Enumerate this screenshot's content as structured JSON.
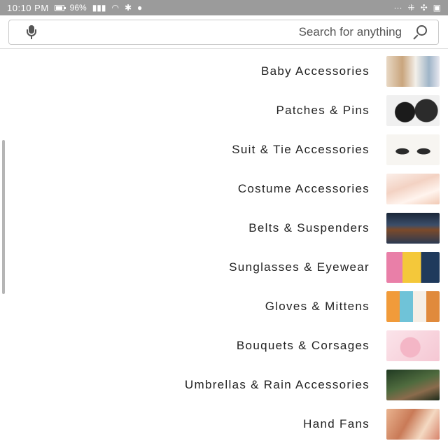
{
  "status_bar": {
    "time": "10:10 PM",
    "battery_percent": "96%",
    "battery_level": 0.96,
    "left_icons": [
      "battery-icon",
      "signal-icon",
      "wifi-icon",
      "bluetooth-icon",
      "location-icon"
    ],
    "right_icons": [
      "more-icon",
      "app-notification-icon",
      "fan-icon",
      "gallery-icon"
    ]
  },
  "search": {
    "placeholder": "Search for anything",
    "value": ""
  },
  "categories": [
    {
      "label": "Baby Accessories"
    },
    {
      "label": "Patches & Pins"
    },
    {
      "label": "Suit & Tie Accessories"
    },
    {
      "label": "Costume Accessories"
    },
    {
      "label": "Belts & Suspenders"
    },
    {
      "label": "Sunglasses & Eyewear"
    },
    {
      "label": "Gloves & Mittens"
    },
    {
      "label": "Bouquets & Corsages"
    },
    {
      "label": "Umbrellas & Rain Accessories"
    },
    {
      "label": "Hand Fans"
    }
  ]
}
